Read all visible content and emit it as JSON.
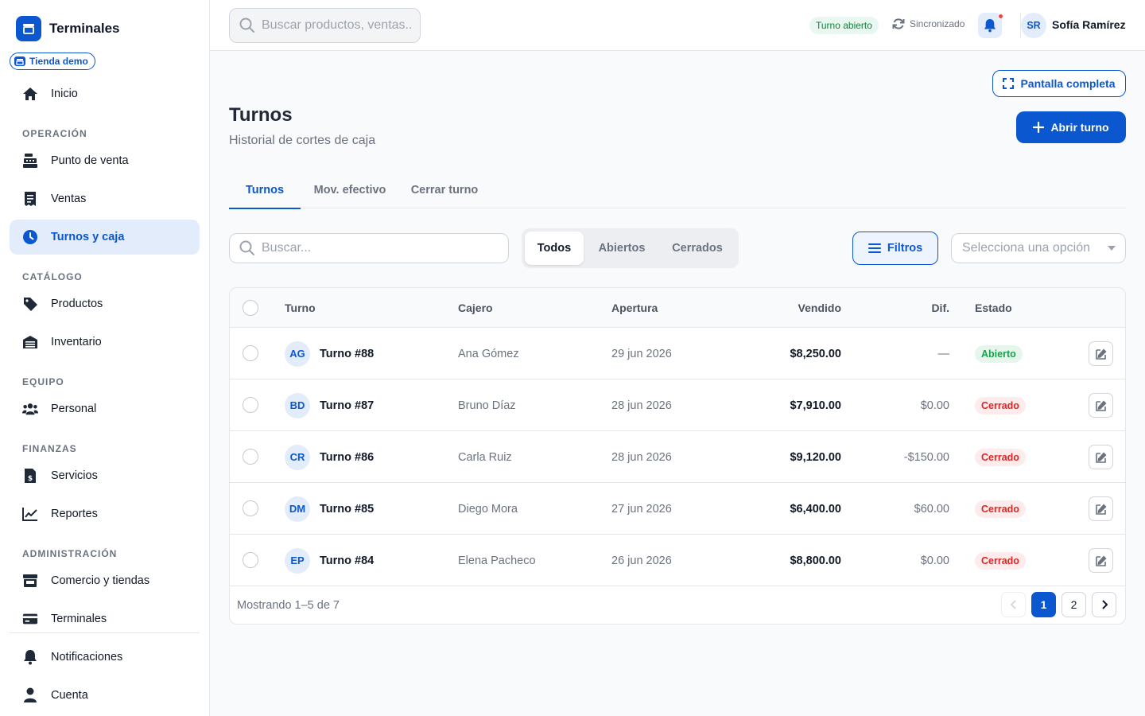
{
  "app": {
    "name": "Terminales",
    "store": "Tienda demo"
  },
  "sidebar": {
    "top": [
      {
        "label": "Inicio",
        "icon": "home-icon"
      }
    ],
    "sections": [
      {
        "title": "OPERACIÓN",
        "items": [
          {
            "label": "Punto de venta",
            "icon": "cash-register-icon"
          },
          {
            "label": "Ventas",
            "icon": "receipt-icon"
          },
          {
            "label": "Turnos y caja",
            "icon": "clock-icon",
            "active": true
          }
        ]
      },
      {
        "title": "CATÁLOGO",
        "items": [
          {
            "label": "Productos",
            "icon": "tag-icon"
          },
          {
            "label": "Inventario",
            "icon": "warehouse-icon"
          }
        ]
      },
      {
        "title": "EQUIPO",
        "items": [
          {
            "label": "Personal",
            "icon": "users-icon"
          }
        ]
      },
      {
        "title": "FINANZAS",
        "items": [
          {
            "label": "Servicios",
            "icon": "invoice-dollar-icon"
          },
          {
            "label": "Reportes",
            "icon": "chart-line-icon"
          }
        ]
      },
      {
        "title": "ADMINISTRACIÓN",
        "items": [
          {
            "label": "Comercio y tiendas",
            "icon": "store-icon"
          },
          {
            "label": "Terminales",
            "icon": "credit-card-icon"
          }
        ]
      }
    ],
    "bottom": [
      {
        "label": "Notificaciones",
        "icon": "bell-icon"
      },
      {
        "label": "Cuenta",
        "icon": "user-icon"
      }
    ]
  },
  "topbar": {
    "search_placeholder": "Buscar productos, ventas...",
    "shift_status": "Turno abierto",
    "sync_status": "Sincronizado",
    "user_initials": "SR",
    "user_name": "Sofía Ramírez"
  },
  "page": {
    "fullscreen_label": "Pantalla completa",
    "title": "Turnos",
    "subtitle": "Historial de cortes de caja",
    "open_shift_label": "Abrir turno",
    "tabs": [
      "Turnos",
      "Mov. efectivo",
      "Cerrar turno"
    ],
    "active_tab": 0,
    "search_placeholder": "Buscar...",
    "segments": [
      "Todos",
      "Abiertos",
      "Cerrados"
    ],
    "active_segment": 0,
    "filters_label": "Filtros",
    "select_placeholder": "Selecciona una opción"
  },
  "table": {
    "headers": {
      "turno": "Turno",
      "cajero": "Cajero",
      "apertura": "Apertura",
      "vendido": "Vendido",
      "dif": "Dif.",
      "estado": "Estado"
    },
    "rows": [
      {
        "initials": "AG",
        "turno": "Turno #88",
        "cajero": "Ana Gómez",
        "apertura": "29 jun 2026",
        "vendido": "$8,250.00",
        "dif": "—",
        "estado": "Abierto",
        "open": true
      },
      {
        "initials": "BD",
        "turno": "Turno #87",
        "cajero": "Bruno Díaz",
        "apertura": "28 jun 2026",
        "vendido": "$7,910.00",
        "dif": "$0.00",
        "estado": "Cerrado",
        "open": false
      },
      {
        "initials": "CR",
        "turno": "Turno #86",
        "cajero": "Carla Ruiz",
        "apertura": "28 jun 2026",
        "vendido": "$9,120.00",
        "dif": "-$150.00",
        "estado": "Cerrado",
        "open": false
      },
      {
        "initials": "DM",
        "turno": "Turno #85",
        "cajero": "Diego Mora",
        "apertura": "27 jun 2026",
        "vendido": "$6,400.00",
        "dif": "$60.00",
        "estado": "Cerrado",
        "open": false
      },
      {
        "initials": "EP",
        "turno": "Turno #84",
        "cajero": "Elena Pacheco",
        "apertura": "26 jun 2026",
        "vendido": "$8,800.00",
        "dif": "$0.00",
        "estado": "Cerrado",
        "open": false
      }
    ],
    "footer_text": "Mostrando 1–5 de 7",
    "pages": [
      "1",
      "2"
    ],
    "current_page": "1"
  },
  "colors": {
    "accent": "#0b57d0",
    "open": "#16a34a",
    "closed": "#dc2626"
  }
}
